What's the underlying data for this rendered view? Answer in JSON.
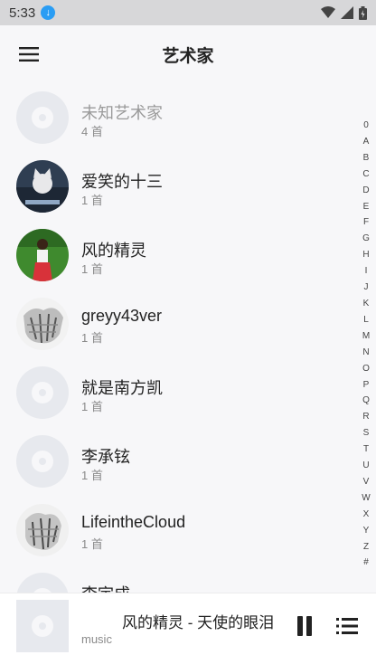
{
  "status": {
    "time": "5:33",
    "download_glyph": "↓"
  },
  "appbar": {
    "title": "艺术家"
  },
  "artists": [
    {
      "name": "未知艺术家",
      "count": "4 首",
      "avatar": "disc",
      "dim": true
    },
    {
      "name": "爱笑的十三",
      "count": "1 首",
      "avatar": "cat"
    },
    {
      "name": "风的精灵",
      "count": "1 首",
      "avatar": "girl"
    },
    {
      "name": "greyy43ver",
      "count": "1 首",
      "avatar": "sketch"
    },
    {
      "name": "就是南方凯",
      "count": "1 首",
      "avatar": "disc"
    },
    {
      "name": "李承铉",
      "count": "1 首",
      "avatar": "disc"
    },
    {
      "name": "LifeintheCloud",
      "count": "1 首",
      "avatar": "sketch"
    },
    {
      "name": "李宇成",
      "count": "",
      "avatar": "disc"
    }
  ],
  "index_letters": [
    "0",
    "A",
    "B",
    "C",
    "D",
    "E",
    "F",
    "G",
    "H",
    "I",
    "J",
    "K",
    "L",
    "M",
    "N",
    "O",
    "P",
    "Q",
    "R",
    "S",
    "T",
    "U",
    "V",
    "W",
    "X",
    "Y",
    "Z",
    "#"
  ],
  "player": {
    "title": "风的精灵 - 天使的眼泪",
    "subtitle": "music"
  },
  "colors": {
    "background": "#f7f7f9",
    "disc": "#e7e9ee",
    "statusbar": "#d7d7d9",
    "accent": "#2a9df4"
  }
}
